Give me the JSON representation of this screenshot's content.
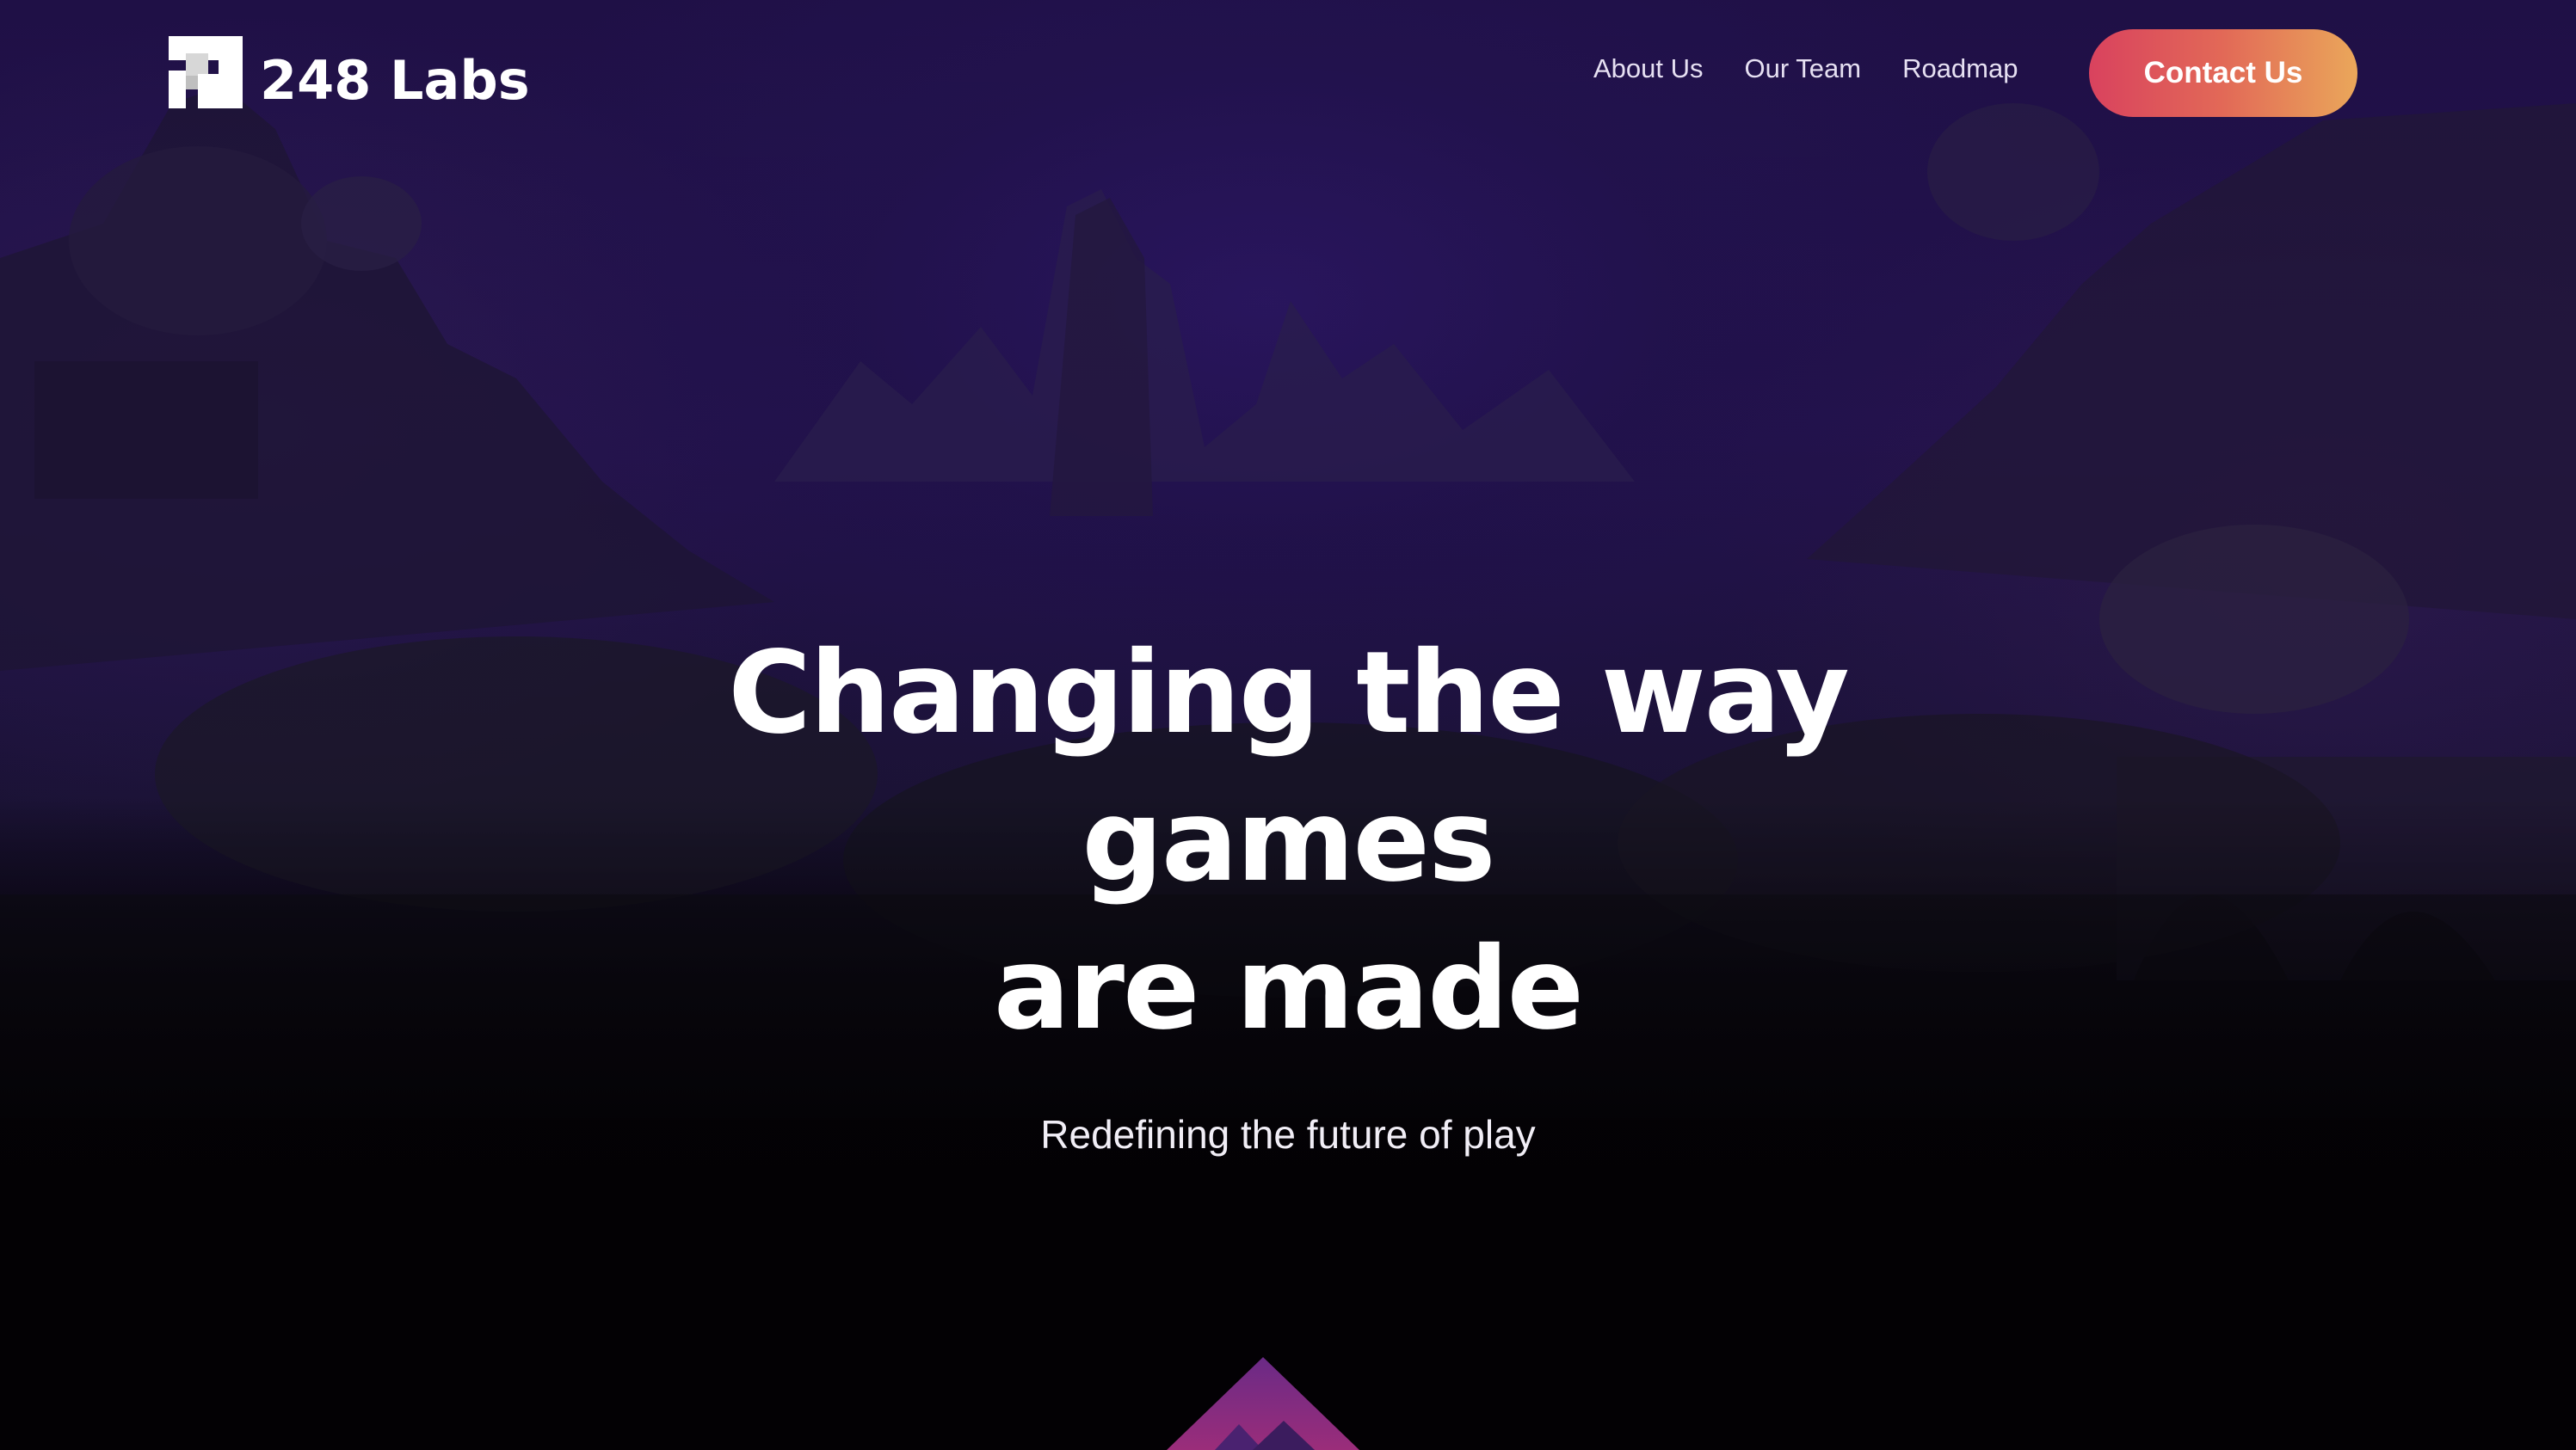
{
  "header": {
    "brand": "248 Labs",
    "nav": [
      {
        "label": "About Us"
      },
      {
        "label": "Our Team"
      },
      {
        "label": "Roadmap"
      }
    ],
    "cta_label": "Contact Us"
  },
  "hero": {
    "title_line1": "Changing the way games",
    "title_line2": "are made",
    "subtitle": "Redefining the future of play"
  },
  "colors": {
    "background": "#1f1046",
    "cta_gradient_start": "#d9425e",
    "cta_gradient_end": "#eaa75a",
    "text": "#ffffff"
  },
  "icons": {
    "logo": "pixel-staircase-logo-icon",
    "scroll_hint": "triangle-mountain-icon"
  }
}
